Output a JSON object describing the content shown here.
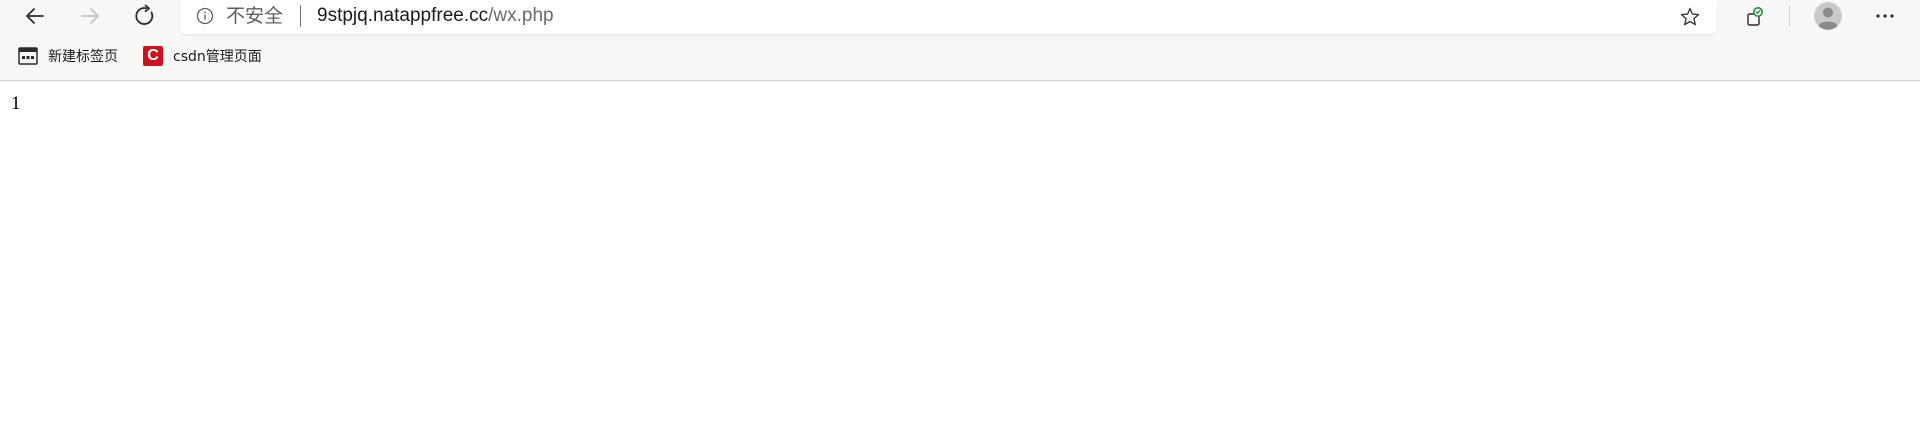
{
  "browser": {
    "address_bar": {
      "security_label": "不安全",
      "url_host": "9stpjq.natappfree.cc",
      "url_path": "/wx.php"
    },
    "toolbar": {
      "back_icon": "arrow-left-icon",
      "forward_icon": "arrow-right-icon",
      "reload_icon": "reload-icon",
      "info_icon": "info-icon",
      "favorite_icon": "star-icon",
      "extension_icon": "extension-icon",
      "profile_icon": "avatar-icon",
      "more_icon": "more-icon"
    },
    "bookmarks": [
      {
        "label": "新建标签页",
        "icon": "new-tab-icon"
      },
      {
        "label": "csdn管理页面",
        "icon": "csdn-icon"
      }
    ]
  },
  "page": {
    "body_text": "1"
  },
  "colors": {
    "chrome_bg": "#f7f7f7",
    "csdn_brand": "#c8141e",
    "extension_accent": "#2e8b3a"
  }
}
